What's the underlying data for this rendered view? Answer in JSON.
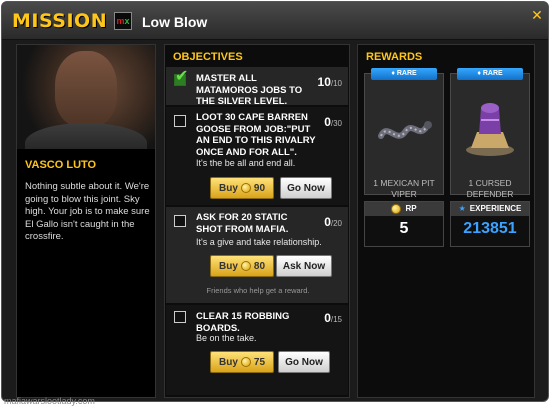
{
  "header": {
    "mission_label": "MISSION :",
    "badge": {
      "m": "m",
      "x": "x"
    },
    "job_title": "Low Blow",
    "close_icon": "close-icon"
  },
  "character": {
    "name": "VASCO LUTO",
    "description": "Nothing subtle about it. We're going to blow this joint. Sky high. Your job is to make sure El Gallo isn't caught in the crossfire."
  },
  "objectives": {
    "title": "OBJECTIVES",
    "items": [
      {
        "text": "MASTER ALL MATAMOROS JOBS TO THE SILVER LEVEL.",
        "count": "10",
        "total": "/10",
        "done": true
      },
      {
        "text": "LOOT 30 CAPE BARREN GOOSE FROM JOB:\"PUT AN END TO THIS RIVALRY ONCE AND FOR ALL\".",
        "count": "0",
        "total": "/30",
        "flavor": "It's the be all and end all.",
        "buy_label": "Buy",
        "buy_cost": "90",
        "action_label": "Go Now"
      },
      {
        "text": "ASK FOR 20 STATIC SHOT FROM MAFIA.",
        "count": "0",
        "total": "/20",
        "flavor": "It's a give and take relationship.",
        "buy_label": "Buy",
        "buy_cost": "80",
        "action_label": "Ask Now",
        "note": "Friends who help get a reward."
      },
      {
        "text": "CLEAR 15 ROBBING BOARDS.",
        "count": "0",
        "total": "/15",
        "flavor": "Be on the take.",
        "buy_label": "Buy",
        "buy_cost": "75",
        "action_label": "Go Now"
      }
    ]
  },
  "rewards": {
    "title": "REWARDS",
    "items": [
      {
        "rarity": "RARE",
        "name": "1 MEXICAN PIT VIPER",
        "icon": "snake-icon"
      },
      {
        "rarity": "RARE",
        "name": "1 CURSED DEFENDER",
        "icon": "armor-icon"
      }
    ],
    "rp": {
      "label": "RP",
      "value": "5",
      "color": "#ffffff"
    },
    "experience": {
      "label": "EXPERIENCE",
      "value": "213851",
      "color": "#3ba3ff"
    }
  },
  "watermark": "mafiawarslootlady.com",
  "colors": {
    "accent": "#ffc61a",
    "rare": "#1e8ae6",
    "xp": "#3ba3ff"
  }
}
